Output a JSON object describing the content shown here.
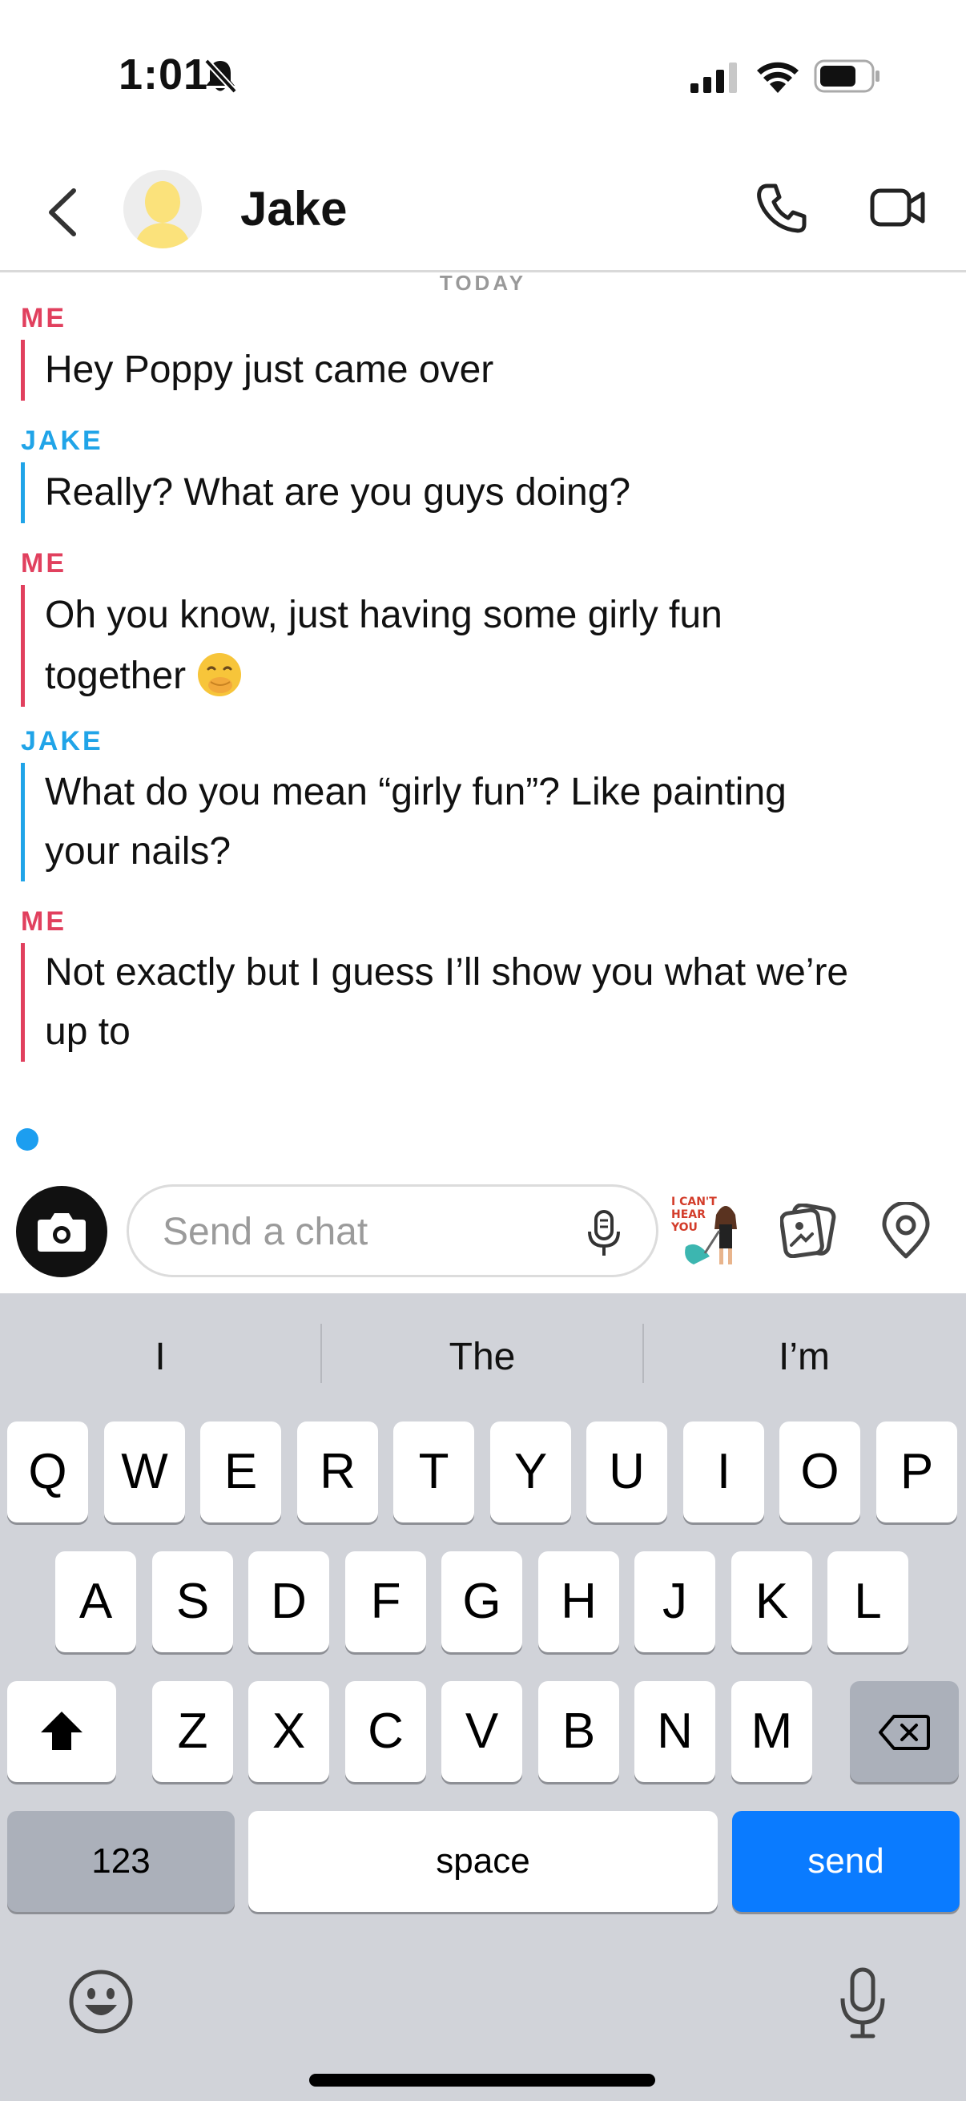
{
  "status_bar": {
    "time": "1:01",
    "icons": [
      "bell-slash-icon",
      "cellular-signal-icon",
      "wifi-icon",
      "battery-icon"
    ]
  },
  "header": {
    "contact_name": "Jake",
    "icons": [
      "back-chevron-icon",
      "avatar",
      "phone-icon",
      "video-camera-icon"
    ]
  },
  "chat": {
    "day_label": "TODAY",
    "messages": [
      {
        "sender": "ME",
        "text": "Hey Poppy just came over"
      },
      {
        "sender": "JAKE",
        "text": "Really? What are you guys doing?"
      },
      {
        "sender": "ME",
        "text": "Oh you know, just having some girly fun",
        "text2": "together",
        "emoji": "face-with-hand-over-mouth"
      },
      {
        "sender": "JAKE",
        "text": "What do you mean “girly fun”? Like painting",
        "text2": "your nails?"
      },
      {
        "sender": "ME",
        "text": "Not exactly but I guess I’ll show you what we’re",
        "text2": "up to"
      }
    ],
    "typing_indicator": true
  },
  "compose": {
    "placeholder": "Send a chat",
    "sticker_text": "I CAN'T HEAR YOU",
    "icons": [
      "camera-icon",
      "microphone-icon",
      "bitmoji-sticker",
      "memories-icon",
      "location-pin-icon"
    ]
  },
  "keyboard": {
    "suggestions": [
      "I",
      "The",
      "I’m"
    ],
    "row1": [
      "Q",
      "W",
      "E",
      "R",
      "T",
      "Y",
      "U",
      "I",
      "O",
      "P"
    ],
    "row2": [
      "A",
      "S",
      "D",
      "F",
      "G",
      "H",
      "J",
      "K",
      "L"
    ],
    "row3": [
      "Z",
      "X",
      "C",
      "V",
      "B",
      "N",
      "M"
    ],
    "numbers_key": "123",
    "space_key": "space",
    "send_key": "send",
    "colors": {
      "send": "#0a7bff",
      "background": "#d1d3d9"
    }
  },
  "colors": {
    "me": "#e1405e",
    "jake": "#20a4e8"
  }
}
